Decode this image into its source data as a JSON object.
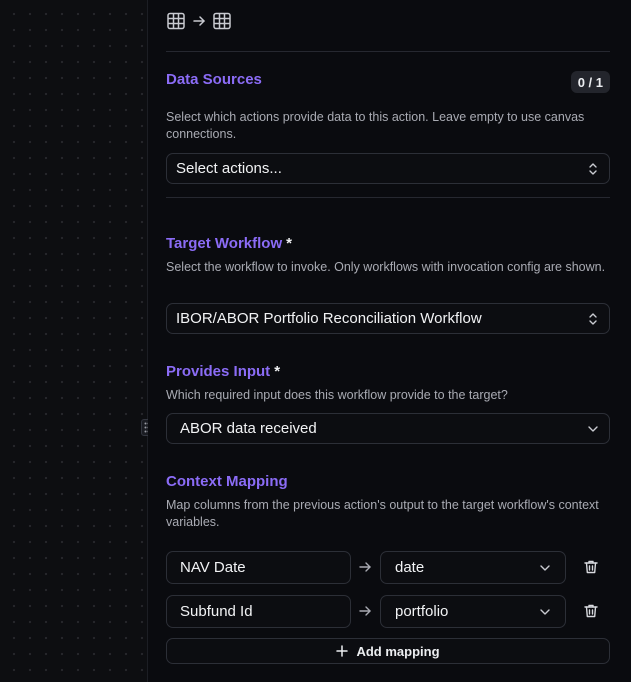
{
  "sections": {
    "data_sources": {
      "title": "Data Sources",
      "count": "0 / 1",
      "description": "Select which actions provide data to this action. Leave empty to use canvas connections.",
      "select_placeholder": "Select actions..."
    },
    "target_workflow": {
      "title": "Target Workflow",
      "required_mark": "*",
      "description": "Select the workflow to invoke. Only workflows with invocation config are shown.",
      "selected": "IBOR/ABOR Portfolio Reconciliation Workflow"
    },
    "provides_input": {
      "title": "Provides Input",
      "required_mark": "*",
      "description": "Which required input does this workflow provide to the target?",
      "selected": "ABOR data received"
    },
    "context_mapping": {
      "title": "Context Mapping",
      "description": "Map columns from the previous action's output to the target workflow's context variables.",
      "rows": [
        {
          "source": "NAV Date",
          "target": "date"
        },
        {
          "source": "Subfund Id",
          "target": "portfolio"
        }
      ],
      "add_label": "Add mapping"
    }
  },
  "icons": {
    "top_left": "table-icon",
    "top_arrow": "arrow-right-icon",
    "top_right": "table-icon"
  },
  "colors": {
    "accent": "#8b6cf6",
    "background": "#0a0b0f"
  }
}
